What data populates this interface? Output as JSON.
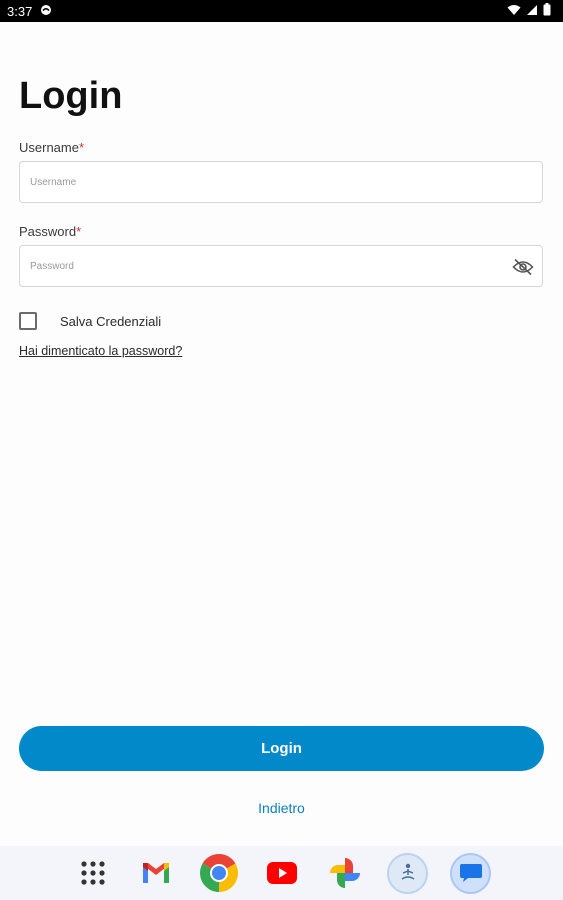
{
  "status_bar": {
    "time": "3:37",
    "left_icons": [
      "sync-icon"
    ],
    "right_icons": [
      "wifi-icon",
      "signal-icon",
      "battery-icon"
    ]
  },
  "page": {
    "title": "Login"
  },
  "form": {
    "username": {
      "label": "Username",
      "required_mark": "*",
      "placeholder": "Username",
      "value": ""
    },
    "password": {
      "label": "Password",
      "required_mark": "*",
      "placeholder": "Password",
      "value": "",
      "toggle_icon": "eye-off-icon"
    },
    "remember": {
      "label": "Salva Credenziali",
      "checked": false
    },
    "forgot_link": "Hai dimenticato la password?"
  },
  "actions": {
    "login_label": "Login",
    "back_label": "Indietro",
    "accent_color": "#0289c9"
  },
  "dock": {
    "apps": [
      "app-drawer-icon",
      "gmail-icon",
      "chrome-icon",
      "youtube-icon",
      "photos-icon",
      "meditation-app-icon",
      "messages-icon"
    ]
  }
}
